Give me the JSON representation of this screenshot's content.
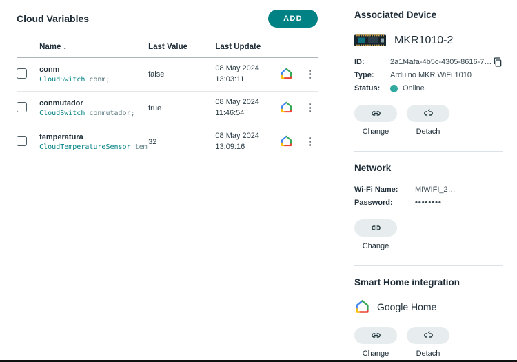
{
  "icons": {
    "sort_desc": "↓",
    "kebab": "⋮"
  },
  "colors": {
    "accent_teal": "#008184",
    "online_green": "#31a8a0",
    "code_teal": "#008184"
  },
  "left": {
    "title": "Cloud Variables",
    "add_button": "ADD",
    "table": {
      "headers": [
        "Name",
        "Last Value",
        "Last Update"
      ],
      "rows": [
        {
          "name": "conm",
          "type": "CloudSwitch",
          "declaration": "conm;",
          "last_value": "false",
          "date": "08 May 2024",
          "time": "13:03:11"
        },
        {
          "name": "conmutador",
          "type": "CloudSwitch",
          "declaration": "conmutador;",
          "last_value": "true",
          "date": "08 May 2024",
          "time": "11:46:54"
        },
        {
          "name": "temperatura",
          "type": "CloudTemperatureSensor",
          "declaration": "temp…",
          "last_value": "32",
          "date": "08 May 2024",
          "time": "13:09:16"
        }
      ]
    }
  },
  "right": {
    "device": {
      "title": "Associated Device",
      "name": "MKR1010-2",
      "id_label": "ID:",
      "id_value": "2a1f4afa-4b5c-4305-8616-7…",
      "type_label": "Type:",
      "type_value": "Arduino MKR WiFi 1010",
      "status_label": "Status:",
      "status_value": "Online",
      "change_label": "Change",
      "detach_label": "Detach"
    },
    "network": {
      "title": "Network",
      "wifi_label": "Wi-Fi Name:",
      "wifi_value": "MIWIFI_2…",
      "password_label": "Password:",
      "password_value": "••••••••",
      "change_label": "Change"
    },
    "smart_home": {
      "title": "Smart Home integration",
      "service": "Google Home",
      "change_label": "Change",
      "detach_label": "Detach"
    }
  }
}
